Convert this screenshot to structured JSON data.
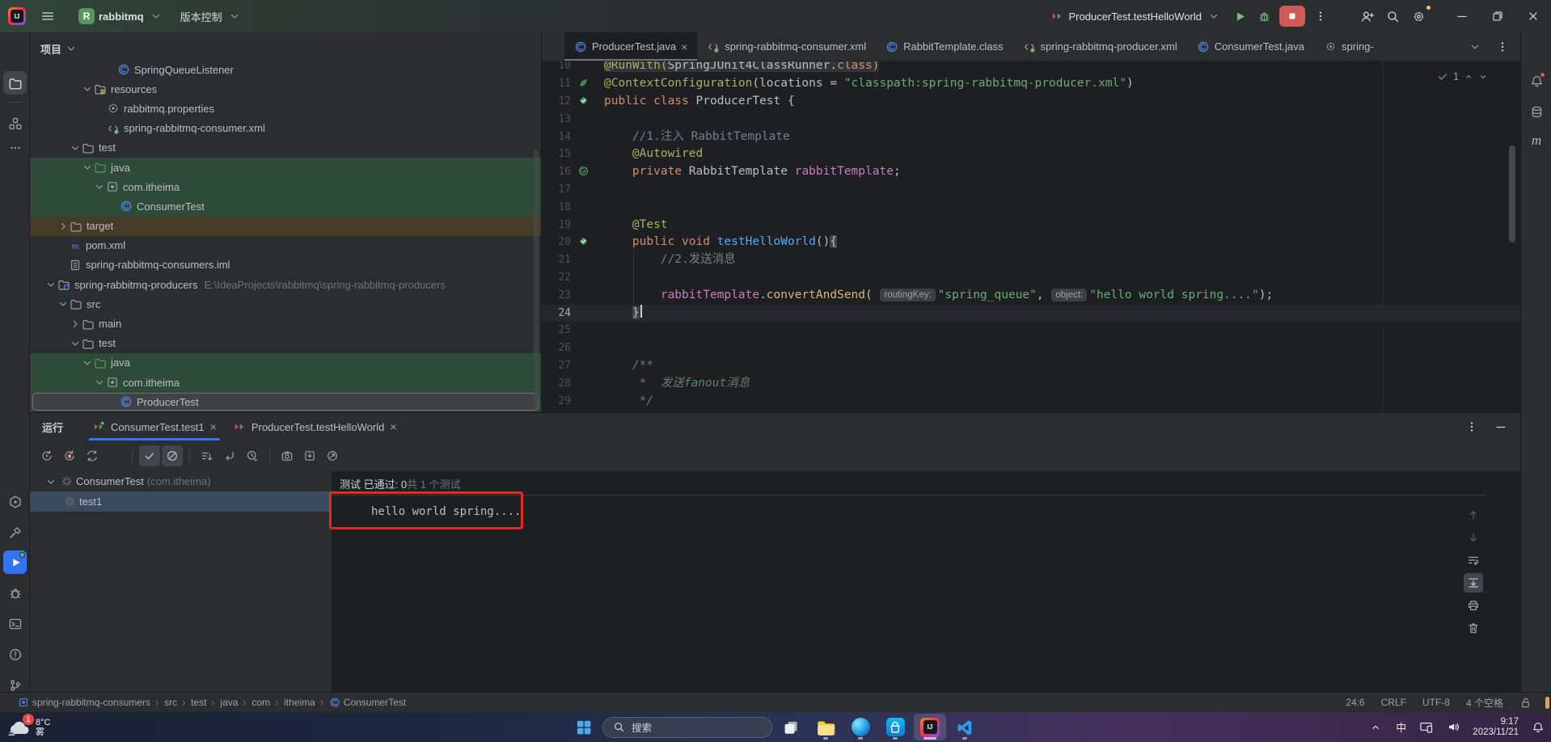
{
  "titlebar": {
    "project": "rabbitmq",
    "vcs": "版本控制",
    "run_config": "ProducerTest.testHelloWorld"
  },
  "activity_bar": {
    "top": [
      "project",
      "structure",
      "more"
    ],
    "bottom": [
      "services",
      "build",
      "run",
      "debug",
      "terminal",
      "problems",
      "version-control"
    ]
  },
  "project_tree": {
    "header": "项目",
    "rows": [
      {
        "label": "SpringQueueListener",
        "icon": "class",
        "pad": 108
      },
      {
        "label": "resources",
        "icon": "folder-resources",
        "chev": "down",
        "pad": 63
      },
      {
        "label": "rabbitmq.properties",
        "icon": "properties",
        "pad": 95
      },
      {
        "label": "spring-rabbitmq-consumer.xml",
        "icon": "spring-xml",
        "pad": 95
      },
      {
        "label": "test",
        "icon": "folder",
        "chev": "down",
        "pad": 48
      },
      {
        "label": "java",
        "icon": "folder-green",
        "chev": "down",
        "pad": 63,
        "bg": "green"
      },
      {
        "label": "com.itheima",
        "icon": "package",
        "chev": "down",
        "pad": 78,
        "bg": "green"
      },
      {
        "label": "ConsumerTest",
        "icon": "class",
        "pad": 111,
        "bg": "green"
      },
      {
        "label": "target",
        "icon": "folder",
        "chev": "right",
        "pad": 33,
        "bg": "amber"
      },
      {
        "label": "pom.xml",
        "icon": "maven",
        "pad": 48
      },
      {
        "label": "spring-rabbitmq-consumers.iml",
        "icon": "iml",
        "pad": 48
      },
      {
        "label": "spring-rabbitmq-producers",
        "sub": "E:\\IdeaProjects\\rabbitmq\\spring-rabbitmq-producers",
        "icon": "module",
        "chev": "down",
        "pad": 18
      },
      {
        "label": "src",
        "icon": "folder",
        "chev": "down",
        "pad": 33
      },
      {
        "label": "main",
        "icon": "folder",
        "chev": "right",
        "pad": 48
      },
      {
        "label": "test",
        "icon": "folder",
        "chev": "down",
        "pad": 48
      },
      {
        "label": "java",
        "icon": "folder-green",
        "chev": "down",
        "pad": 63,
        "bg": "green"
      },
      {
        "label": "com.itheima",
        "icon": "package",
        "chev": "down",
        "pad": 78,
        "bg": "green"
      },
      {
        "label": "ProducerTest",
        "icon": "class",
        "pad": 111,
        "bg": "green",
        "selected": true
      }
    ]
  },
  "editor_tabs": [
    {
      "label": "ProducerTest.java",
      "icon": "class",
      "active": true,
      "close": true
    },
    {
      "label": "spring-rabbitmq-consumer.xml",
      "icon": "spring-xml"
    },
    {
      "label": "RabbitTemplate.class",
      "icon": "class"
    },
    {
      "label": "spring-rabbitmq-producer.xml",
      "icon": "spring-xml"
    },
    {
      "label": "ConsumerTest.java",
      "icon": "class"
    },
    {
      "label": "spring-",
      "icon": "gear-small"
    }
  ],
  "inspection": {
    "count": "1"
  },
  "code": {
    "lines": [
      {
        "n": 10,
        "tint": true,
        "t": [
          [
            "ann",
            "@RunWith("
          ],
          [
            "p",
            "SpringJUnit4ClassRunner."
          ],
          [
            "k",
            "class"
          ],
          [
            "ann",
            ")"
          ]
        ]
      },
      {
        "n": 11,
        "g": "spring-leaf",
        "t": [
          [
            "ann",
            "@ContextConfiguration"
          ],
          [
            "p",
            "(locations = "
          ],
          [
            "s",
            "\"classpath:spring-rabbitmq-producer.xml\""
          ],
          [
            "p",
            ")"
          ]
        ]
      },
      {
        "n": 12,
        "g": "run-test",
        "t": [
          [
            "k",
            "public class "
          ],
          [
            "p",
            "ProducerTest {"
          ]
        ]
      },
      {
        "n": 13,
        "t": []
      },
      {
        "n": 14,
        "t": [
          [
            "c",
            "    //1.注入 RabbitTemplate"
          ]
        ]
      },
      {
        "n": 15,
        "t": [
          [
            "ann",
            "    @Autowired"
          ]
        ]
      },
      {
        "n": 16,
        "g": "spring-bean",
        "t": [
          [
            "k",
            "    private "
          ],
          [
            "p",
            "RabbitTemplate "
          ],
          [
            "f",
            "rabbitTemplate"
          ],
          [
            "p",
            ";"
          ]
        ]
      },
      {
        "n": 17,
        "t": []
      },
      {
        "n": 18,
        "t": []
      },
      {
        "n": 19,
        "t": [
          [
            "ann",
            "    @Test"
          ]
        ]
      },
      {
        "n": 20,
        "g": "run-test",
        "t": [
          [
            "k",
            "    public void "
          ],
          [
            "md",
            "testHelloWorld"
          ],
          [
            "p",
            "()"
          ],
          [
            "b",
            "{"
          ]
        ]
      },
      {
        "n": 21,
        "t": [
          [
            "c",
            "        //2.发送消息"
          ]
        ]
      },
      {
        "n": 22,
        "t": []
      },
      {
        "n": 23,
        "t": [
          [
            "f",
            "        rabbitTemplate"
          ],
          [
            "p",
            "."
          ],
          [
            "mc",
            "convertAndSend"
          ],
          [
            "p",
            "( "
          ],
          [
            "chip",
            "routingKey:"
          ],
          [
            "s",
            "\"spring_queue\""
          ],
          [
            "p",
            ", "
          ],
          [
            "chip",
            "object:"
          ],
          [
            "s",
            "\"hello world spring....\""
          ],
          [
            "p",
            ");"
          ]
        ]
      },
      {
        "n": 24,
        "cur": true,
        "t": [
          [
            "p",
            "    "
          ],
          [
            "b",
            "}"
          ],
          [
            "caret",
            ""
          ]
        ]
      },
      {
        "n": 25,
        "t": []
      },
      {
        "n": 26,
        "t": []
      },
      {
        "n": 27,
        "t": [
          [
            "doc",
            "    /**"
          ]
        ]
      },
      {
        "n": 28,
        "t": [
          [
            "doc",
            "     *  发送fanout消息"
          ]
        ]
      },
      {
        "n": 29,
        "t": [
          [
            "doc",
            "     */"
          ]
        ]
      }
    ]
  },
  "run_panel": {
    "title": "运行",
    "tabs": [
      {
        "label": "ConsumerTest.test1",
        "active": true,
        "running": true
      },
      {
        "label": "ProducerTest.testHelloWorld"
      }
    ],
    "toolbar": [
      "rerun",
      "rerun-failed",
      "autotest",
      "stop",
      "|",
      "show-passed:on",
      "show-ignored:on",
      "|",
      "sort",
      "navigate",
      "clock",
      "|",
      "camera",
      "import",
      "pin",
      "kebab"
    ],
    "tree": [
      {
        "label": "ConsumerTest",
        "sub": "(com.itheima)",
        "chev": "down",
        "icon": "spinner"
      },
      {
        "label": "test1",
        "icon": "spinner",
        "selected": true,
        "indent": 24
      }
    ],
    "status_passed": "测试 已通过: 0",
    "status_total": "共 1 个测试",
    "console_output": "hello world spring....",
    "console_icons": [
      "up:dim",
      "down:dim",
      "soft-wrap",
      "scroll-end:on",
      "print",
      "trash"
    ]
  },
  "status_bar": {
    "breadcrumbs": [
      "spring-rabbitmq-consumers",
      "src",
      "test",
      "java",
      "com",
      "itheima",
      "ConsumerTest"
    ],
    "caret": "24:6",
    "line_separator": "CRLF",
    "encoding": "UTF-8",
    "indent": "4 个空格"
  },
  "taskbar": {
    "weather_badge": "1",
    "weather_temp": "8°C",
    "weather_cond": "雾",
    "search_placeholder": "搜索",
    "apps": [
      "task-view",
      "explorer:dot",
      "edge:dot",
      "store:dot",
      "idea:active",
      "vscode:dot"
    ],
    "ime": "中",
    "time": "9:17",
    "date": "2023/11/21"
  }
}
